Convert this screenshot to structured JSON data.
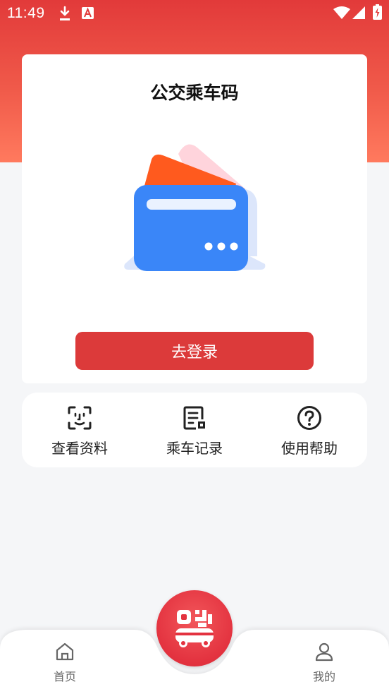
{
  "status_bar": {
    "time": "11:49",
    "icons": [
      "download-icon",
      "text-a-icon",
      "wifi-icon",
      "cell-signal-icon",
      "battery-charging-icon"
    ]
  },
  "card": {
    "title": "公交乘车码",
    "illustration_icon": "bus-card-wallet-icon",
    "login_label": "去登录"
  },
  "quick_menu": {
    "items": [
      {
        "label": "查看资料",
        "icon": "face-scan-icon"
      },
      {
        "label": "乘车记录",
        "icon": "document-list-icon"
      },
      {
        "label": "使用帮助",
        "icon": "help-circle-icon"
      }
    ]
  },
  "bottom_nav": {
    "items": [
      {
        "label": "首页",
        "icon": "home-icon"
      },
      {
        "label": "我的",
        "icon": "user-icon"
      }
    ],
    "center_icon": "qr-bus-icon"
  },
  "colors": {
    "brand_red": "#dc3a3a",
    "header_gradient_top": "#e23a3a",
    "header_gradient_bottom": "#ff7a5e",
    "card_blue": "#3a86f8",
    "card_orange": "#ff5a1e",
    "card_pink": "#ffd4dc"
  }
}
